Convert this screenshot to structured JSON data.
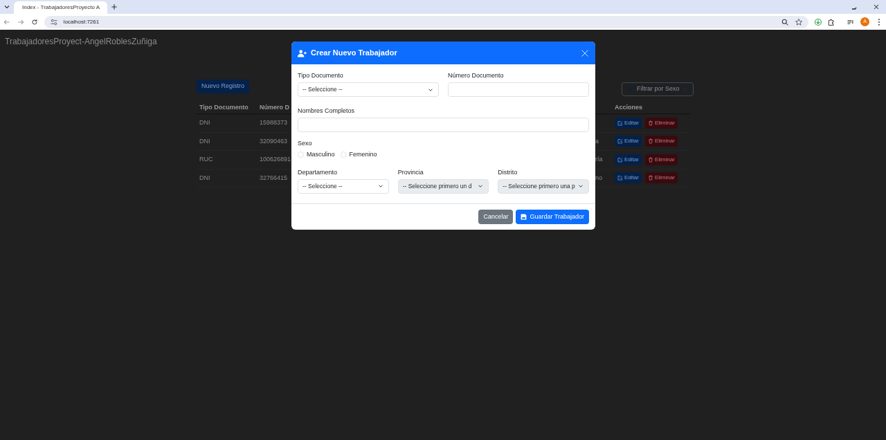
{
  "browser": {
    "tab_title": "Index - TrabajadoresProyecto A",
    "url": "localhost:7261",
    "profile_initial": "A"
  },
  "page": {
    "brand": "TrabajadoresProyect-AngelRoblesZuñiga",
    "new_button": "Nuevo Registro",
    "filter_button": "Filtrar por Sexo",
    "table": {
      "columns": [
        "Tipo Documento",
        "Número D",
        "Acciones"
      ],
      "rows": [
        {
          "tipo": "DNI",
          "numero": "15988373",
          "column_3": "",
          "edit": "Editar",
          "delete": "Eliminar"
        },
        {
          "tipo": "DNI",
          "numero": "32090463",
          "column_3": "a",
          "edit": "Editar",
          "delete": "Eliminar"
        },
        {
          "tipo": "RUC",
          "numero": "100626891",
          "column_3": "ría",
          "edit": "Editar",
          "delete": "Eliminar"
        },
        {
          "tipo": "DNI",
          "numero": "32766415",
          "column_3": "no",
          "edit": "Editar",
          "delete": "Eliminar"
        }
      ]
    }
  },
  "modal": {
    "title": "Crear Nuevo Trabajador",
    "tipo_documento": {
      "label": "Tipo Documento",
      "value": "-- Seleccione --"
    },
    "numero_documento": {
      "label": "Número Documento"
    },
    "nombres": {
      "label": "Nombres Completos"
    },
    "sexo": {
      "label": "Sexo",
      "options": [
        {
          "label": "Masculino",
          "selected": false
        },
        {
          "label": "Femenino",
          "selected": false
        }
      ]
    },
    "ubicacion": [
      {
        "label": "Departamento",
        "value": "-- Seleccione --",
        "disabled": false
      },
      {
        "label": "Provincia",
        "value": "-- Seleccione primero un d",
        "disabled": true
      },
      {
        "label": "Distrito",
        "value": "-- Seleccione primero una p",
        "disabled": true
      }
    ],
    "cancel": "Cancelar",
    "save": "Guardar Trabajador"
  }
}
